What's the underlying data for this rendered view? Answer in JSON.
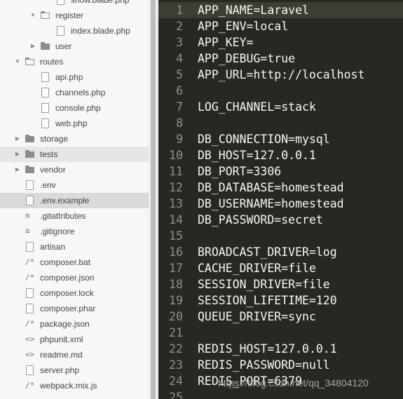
{
  "sidebar": {
    "items": [
      {
        "label": "show.blade.php",
        "type": "file",
        "indent": 3
      },
      {
        "label": "register",
        "type": "folder",
        "expanded": true,
        "indent": 2
      },
      {
        "label": "index.blade.php",
        "type": "file",
        "indent": 3
      },
      {
        "label": "user",
        "type": "folder",
        "expanded": false,
        "indent": 2
      },
      {
        "label": "routes",
        "type": "folder",
        "expanded": true,
        "indent": 1
      },
      {
        "label": "api.php",
        "type": "file",
        "indent": 2
      },
      {
        "label": "channels.php",
        "type": "file",
        "indent": 2
      },
      {
        "label": "console.php",
        "type": "file",
        "indent": 2
      },
      {
        "label": "web.php",
        "type": "file",
        "indent": 2
      },
      {
        "label": "storage",
        "type": "folder",
        "expanded": false,
        "indent": 1
      },
      {
        "label": "tests",
        "type": "folder",
        "expanded": false,
        "indent": 1,
        "state": "hover"
      },
      {
        "label": "vendor",
        "type": "folder",
        "expanded": false,
        "indent": 1
      },
      {
        "label": ".env",
        "type": "file",
        "indent": 1
      },
      {
        "label": ".env.example",
        "type": "file",
        "indent": 1,
        "state": "selected"
      },
      {
        "label": ".gitattributes",
        "type": "text",
        "indent": 1
      },
      {
        "label": ".gitignore",
        "type": "text",
        "indent": 1
      },
      {
        "label": "artisan",
        "type": "file",
        "indent": 1
      },
      {
        "label": "composer.bat",
        "type": "code",
        "indent": 1
      },
      {
        "label": "composer.json",
        "type": "code",
        "indent": 1
      },
      {
        "label": "composer.lock",
        "type": "file",
        "indent": 1
      },
      {
        "label": "composer.phar",
        "type": "file",
        "indent": 1
      },
      {
        "label": "package.json",
        "type": "code",
        "indent": 1
      },
      {
        "label": "phpunit.xml",
        "type": "markup",
        "indent": 1
      },
      {
        "label": "readme.md",
        "type": "markup",
        "indent": 1
      },
      {
        "label": "server.php",
        "type": "file",
        "indent": 1
      },
      {
        "label": "webpack.mix.js",
        "type": "code",
        "indent": 1
      }
    ]
  },
  "editor": {
    "active_line": 1,
    "lines": [
      {
        "n": "1",
        "text": "APP_NAME=Laravel"
      },
      {
        "n": "2",
        "text": "APP_ENV=local"
      },
      {
        "n": "3",
        "text": "APP_KEY="
      },
      {
        "n": "4",
        "text": "APP_DEBUG=true"
      },
      {
        "n": "5",
        "text": "APP_URL=http://localhost"
      },
      {
        "n": "6",
        "text": ""
      },
      {
        "n": "7",
        "text": "LOG_CHANNEL=stack"
      },
      {
        "n": "8",
        "text": ""
      },
      {
        "n": "9",
        "text": "DB_CONNECTION=mysql"
      },
      {
        "n": "10",
        "text": "DB_HOST=127.0.0.1"
      },
      {
        "n": "11",
        "text": "DB_PORT=3306"
      },
      {
        "n": "12",
        "text": "DB_DATABASE=homestead"
      },
      {
        "n": "13",
        "text": "DB_USERNAME=homestead"
      },
      {
        "n": "14",
        "text": "DB_PASSWORD=secret"
      },
      {
        "n": "15",
        "text": ""
      },
      {
        "n": "16",
        "text": "BROADCAST_DRIVER=log"
      },
      {
        "n": "17",
        "text": "CACHE_DRIVER=file"
      },
      {
        "n": "18",
        "text": "SESSION_DRIVER=file"
      },
      {
        "n": "19",
        "text": "SESSION_LIFETIME=120"
      },
      {
        "n": "20",
        "text": "QUEUE_DRIVER=sync"
      },
      {
        "n": "21",
        "text": ""
      },
      {
        "n": "22",
        "text": "REDIS_HOST=127.0.0.1"
      },
      {
        "n": "23",
        "text": "REDIS_PASSWORD=null"
      },
      {
        "n": "24",
        "text": "REDIS_PORT=6379"
      },
      {
        "n": "25",
        "text": ""
      }
    ]
  },
  "watermark": "https://blog.csdn.net/qq_34804120",
  "colors": {
    "editor_bg": "#272822",
    "editor_text": "#f8f8f2",
    "line_number": "#8f908a",
    "sidebar_bg": "#f7f7f7",
    "selected_row": "#d9dadb"
  }
}
